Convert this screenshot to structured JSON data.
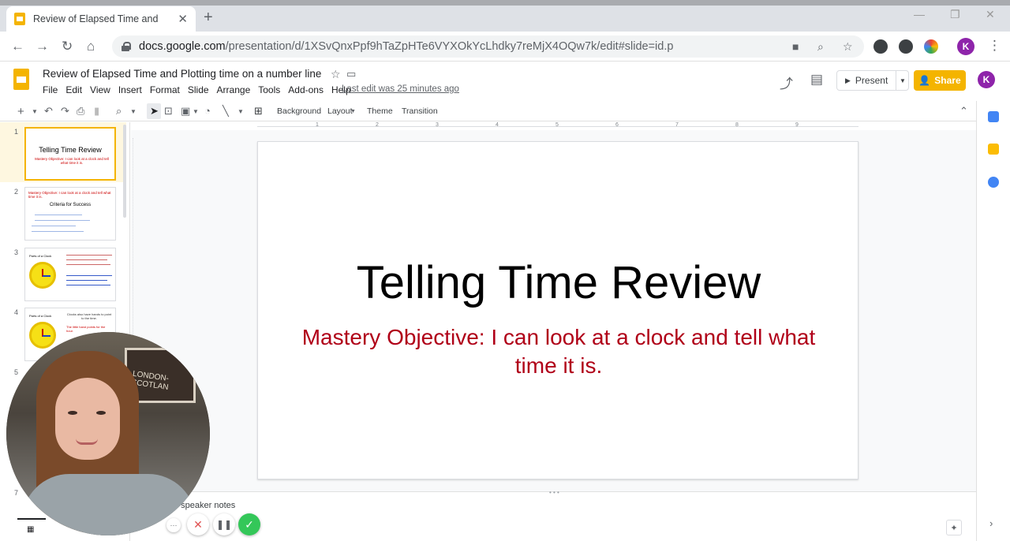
{
  "browser": {
    "tab_title": "Review of Elapsed Time and",
    "tab_close": "✕",
    "new_tab": "+",
    "url_host": "docs.google.com",
    "url_path": "/presentation/d/1XSvQnxPpf9hTaZpHTe6VYXOkYcLhdky7reMjX4OQw7k/edit#slide=id.p",
    "profile_initial": "K"
  },
  "doc": {
    "title": "Review of Elapsed Time and Plotting time on a number line",
    "menu": [
      "File",
      "Edit",
      "View",
      "Insert",
      "Format",
      "Slide",
      "Arrange",
      "Tools",
      "Add-ons",
      "Help"
    ],
    "last_edit": "Last edit was 25 minutes ago",
    "present_label": "Present",
    "share_label": "Share",
    "account_initial": "K"
  },
  "toolbar": {
    "background_label": "Background",
    "layout_label": "Layout",
    "theme_label": "Theme",
    "transition_label": "Transition"
  },
  "ruler_numbers": [
    "1",
    "2",
    "3",
    "4",
    "5",
    "6",
    "7",
    "8",
    "9"
  ],
  "filmstrip": {
    "slides": [
      {
        "num": "1",
        "title": "Telling Time Review",
        "subtitle": "Mastery Objective: I can look at a clock and tell what time it is."
      },
      {
        "num": "2",
        "header": "Mastery Objective: I can look at a clock and tell what time it is.",
        "title": "Criteria for Success"
      },
      {
        "num": "3",
        "label": "Parts of a Clock"
      },
      {
        "num": "4",
        "label": "Parts of a Clock",
        "side_text": "Clocks also have hands to point to the time.",
        "red_text": "The little hand points for the hour."
      },
      {
        "num": "5"
      },
      {
        "num": "7"
      }
    ]
  },
  "slide": {
    "title": "Telling Time Review",
    "subtitle": "Mastery Objective: I can look at a clock and tell what time it is."
  },
  "notes": {
    "placeholder": "d speaker notes"
  },
  "colors": {
    "accent": "#f4b400",
    "subtitle_red": "#b00018",
    "record_green": "#34c759",
    "cancel_red": "#e05252"
  },
  "webcam_text": "LONDON-SCOTLAN"
}
